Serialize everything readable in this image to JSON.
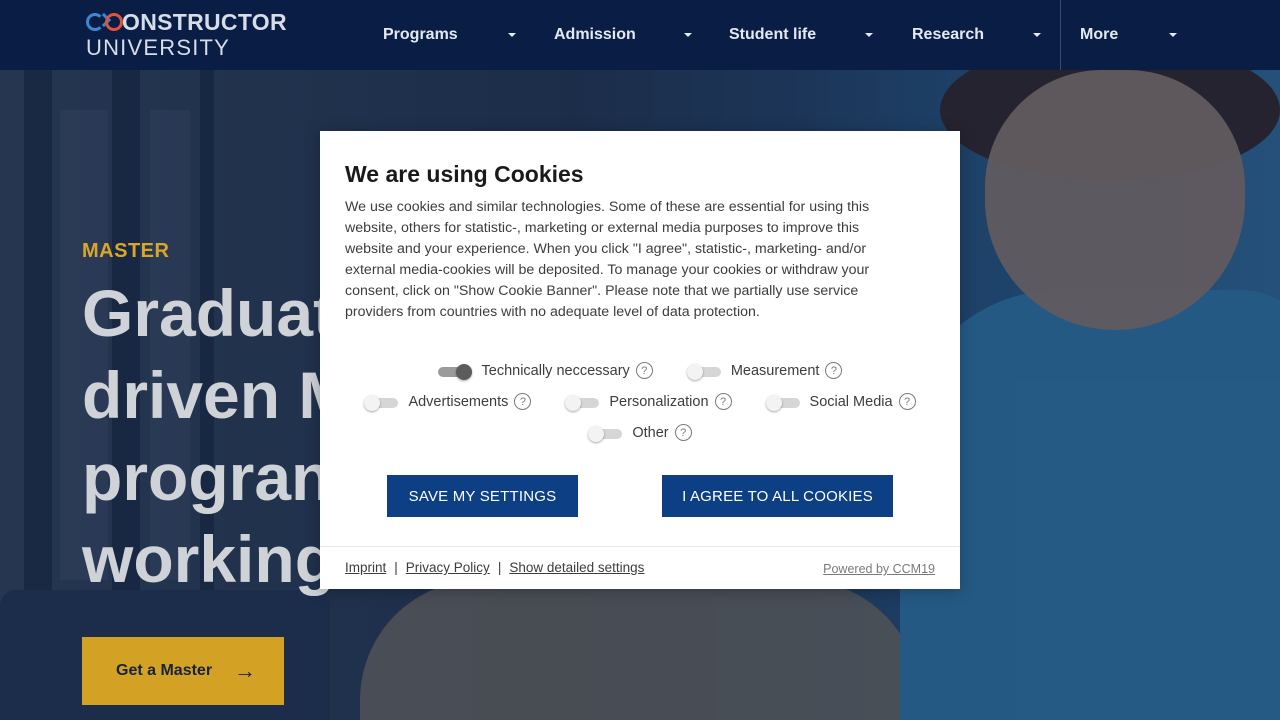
{
  "header": {
    "logo": {
      "brand": "ONSTRUCTOR",
      "sub": "UNIVERSITY"
    },
    "nav": [
      {
        "label": "Programs"
      },
      {
        "label": "Admission"
      },
      {
        "label": "Student life"
      },
      {
        "label": "Research"
      },
      {
        "label": "More"
      }
    ]
  },
  "hero": {
    "label": "MASTER",
    "title_lines": [
      "Graduat",
      "driven M",
      "progran",
      "working"
    ],
    "cta": "Get a Master",
    "cta_arrow": "→"
  },
  "cookie_modal": {
    "title": "We are using Cookies",
    "body": "We use cookies and similar technologies. Some of these are essential for using this website, others for statistic-, marketing or external media purposes to improve this website and your experience. When you click \"I agree\", statistic-, marketing- and/or external media-cookies will be deposited. To manage your cookies or withdraw your consent, click on \"Show Cookie Banner\". Please note that we partially use service providers from countries with no adequate level of data protection.",
    "toggles": [
      {
        "label": "Technically neccessary",
        "on": true
      },
      {
        "label": "Measurement",
        "on": false
      },
      {
        "label": "Advertisements",
        "on": false
      },
      {
        "label": "Personalization",
        "on": false
      },
      {
        "label": "Social Media",
        "on": false
      },
      {
        "label": "Other",
        "on": false
      }
    ],
    "help_glyph": "?",
    "save_button": "SAVE MY SETTINGS",
    "agree_button": "I AGREE TO ALL COOKIES",
    "footer": {
      "imprint": "Imprint",
      "privacy": "Privacy Policy",
      "details": "Show detailed settings",
      "separator": "|",
      "powered_by": "Powered by CCM19"
    }
  },
  "colors": {
    "navy": "#0a1e45",
    "accent_gold": "#d3a224",
    "button_blue": "#0d3f84",
    "logo_blue": "#3b86d6",
    "logo_red": "#e0533a"
  }
}
